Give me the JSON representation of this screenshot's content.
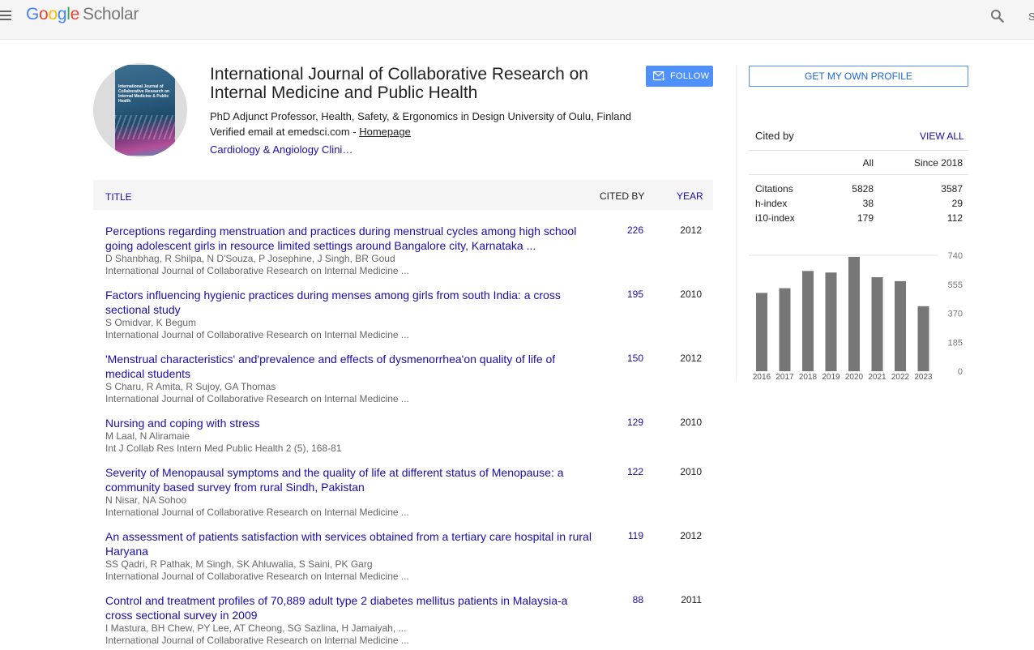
{
  "topbar": {
    "logo": {
      "g1": "G",
      "o1": "o",
      "o2": "o",
      "g2": "g",
      "l": "l",
      "e": "e",
      "scholar": "Scholar"
    },
    "right_text": "S"
  },
  "profile": {
    "cover_title": "International Journal of Collaborative Research on Internal Medicine & Public Health",
    "name": "International Journal of Collaborative Research on Internal Medicine and Public Health",
    "affiliation": "PhD Adjunct Professor, Health, Safety, & Ergonomics in Design University of Oulu, Finland",
    "verified_prefix": "Verified email at emedsci.com - ",
    "homepage": "Homepage",
    "interest": "Cardiology & Angiology Clini…",
    "follow_label": "FOLLOW"
  },
  "table": {
    "col_title": "TITLE",
    "col_cited": "CITED BY",
    "col_year": "YEAR"
  },
  "articles": [
    {
      "title": "Perceptions regarding menstruation and practices during menstrual cycles among high school going adolescent girls in resource limited settings around Bangalore city, Karnataka ...",
      "authors": "D Shanbhag, R Shilpa, N D'Souza, P Josephine, J Singh, BR Goud",
      "venue": "International Journal of Collaborative Research on Internal Medicine ...",
      "cited": "226",
      "year": "2012"
    },
    {
      "title": "Factors influencing hygienic practices during menses among girls from south India: a cross sectional study",
      "authors": "S Omidvar, K Begum",
      "venue": "International Journal of Collaborative Research on Internal Medicine ...",
      "cited": "195",
      "year": "2010"
    },
    {
      "title": "'Menstrual characteristics' and'prevalence and effects of dysmenorrhea'on quality of life of medical students",
      "authors": "S Charu, R Amita, R Sujoy, GA Thomas",
      "venue": "International Journal of Collaborative Research on Internal Medicine ...",
      "cited": "150",
      "year": "2012"
    },
    {
      "title": "Nursing and coping with stress",
      "authors": "M Laal, N Aliramaie",
      "venue": "Int J Collab Res Intern Med Public Health 2 (5), 168-81",
      "cited": "129",
      "year": "2010"
    },
    {
      "title": "Severity of Menopausal symptoms and the quality of life at different status of Menopause: a community based survey from rural Sindh, Pakistan",
      "authors": "N Nisar, NA Sohoo",
      "venue": "International Journal of Collaborative Research on Internal Medicine ...",
      "cited": "122",
      "year": "2010"
    },
    {
      "title": "An assessment of patients satisfaction with services obtained from a tertiary care hospital in rural Haryana",
      "authors": "SS Qadri, R Pathak, M Singh, SK Ahluwalia, S Saini, PK Garg",
      "venue": "International Journal of Collaborative Research on Internal Medicine ...",
      "cited": "119",
      "year": "2012"
    },
    {
      "title": "Control and treatment profiles of 70,889 adult type 2 diabetes mellitus patients in Malaysia-a cross sectional survey in 2009",
      "authors": "I Mastura, BH Chew, PY Lee, AT Cheong, SG Sazlina, H Jamaiyah, ...",
      "venue": "International Journal of Collaborative Research on Internal Medicine ...",
      "cited": "88",
      "year": "2011"
    }
  ],
  "sidebar": {
    "own_profile": "GET MY OWN PROFILE",
    "cited_by": "Cited by",
    "view_all": "VIEW ALL",
    "head_all": "All",
    "head_since": "Since 2018",
    "stats": [
      {
        "label": "Citations",
        "all": "5828",
        "since": "3587"
      },
      {
        "label": "h-index",
        "all": "38",
        "since": "29"
      },
      {
        "label": "i10-index",
        "all": "179",
        "since": "112"
      }
    ]
  },
  "chart_data": {
    "type": "bar",
    "categories": [
      "2016",
      "2017",
      "2018",
      "2019",
      "2020",
      "2021",
      "2022",
      "2023"
    ],
    "values": [
      500,
      530,
      640,
      630,
      730,
      600,
      575,
      415
    ],
    "yticks": [
      "740",
      "555",
      "370",
      "185",
      "0"
    ],
    "ylim": [
      0,
      740
    ],
    "color": "#777777"
  }
}
